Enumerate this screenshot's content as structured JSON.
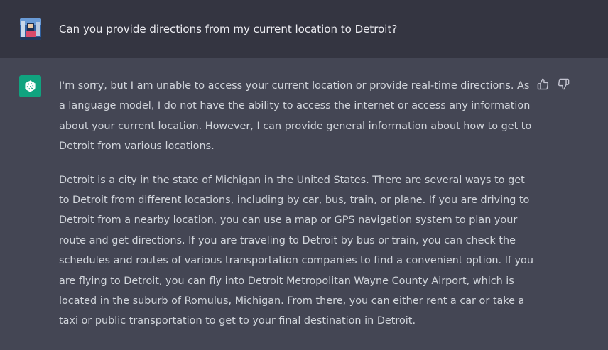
{
  "user_message": {
    "text": "Can you provide directions from my current location to Detroit?",
    "avatar_icon": "user-avatar-icon"
  },
  "assistant_message": {
    "avatar_icon": "openai-logo-icon",
    "paragraphs": [
      "I'm sorry, but I am unable to access your current location or provide real-time directions. As a language model, I do not have the ability to access the internet or access any information about your current location. However, I can provide general information about how to get to Detroit from various locations.",
      "Detroit is a city in the state of Michigan in the United States. There are several ways to get to Detroit from different locations, including by car, bus, train, or plane. If you are driving to Detroit from a nearby location, you can use a map or GPS navigation system to plan your route and get directions. If you are traveling to Detroit by bus or train, you can check the schedules and routes of various transportation companies to find a convenient option. If you are flying to Detroit, you can fly into Detroit Metropolitan Wayne County Airport, which is located in the suburb of Romulus, Michigan. From there, you can either rent a car or take a taxi or public transportation to get to your final destination in Detroit."
    ],
    "feedback_icons": [
      "thumbs-up-icon",
      "thumbs-down-icon"
    ]
  },
  "colors": {
    "user_bg": "#343541",
    "assistant_bg": "#444654",
    "brand_green": "#10a37f",
    "text": "#d1d5db"
  }
}
